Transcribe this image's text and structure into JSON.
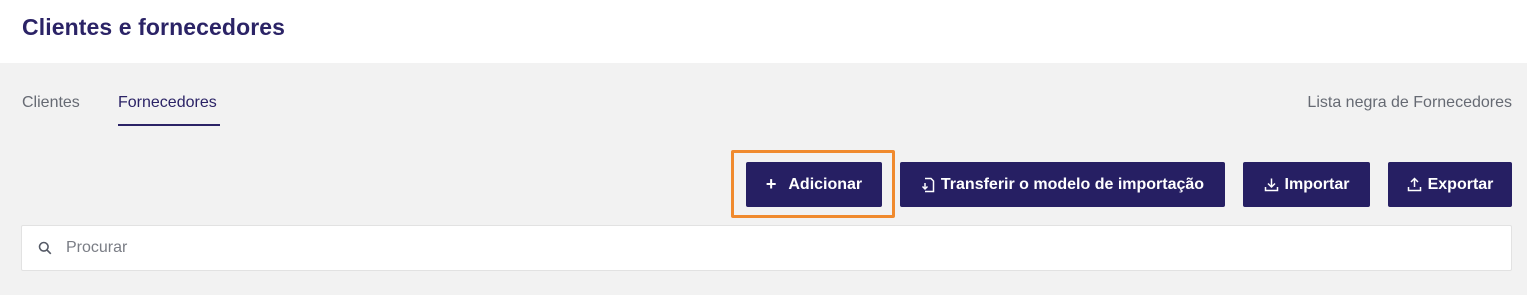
{
  "page": {
    "title": "Clientes e fornecedores"
  },
  "tabs": [
    {
      "label": "Clientes",
      "active": false
    },
    {
      "label": "Fornecedores",
      "active": true
    }
  ],
  "blacklist_link": "Lista negra de Fornecedores",
  "toolbar": {
    "add_label": "Adicionar",
    "template_label": "Transferir o modelo de importação",
    "import_label": "Importar",
    "export_label": "Exportar"
  },
  "search": {
    "placeholder": "Procurar",
    "value": ""
  },
  "colors": {
    "primary": "#261f63",
    "title": "#2b2366",
    "highlight": "#f08a2e",
    "background": "#f2f2f2"
  },
  "icons": {
    "add": "plus-icon",
    "template": "file-transfer-icon",
    "import": "download-icon",
    "export": "upload-icon",
    "search": "search-icon"
  }
}
